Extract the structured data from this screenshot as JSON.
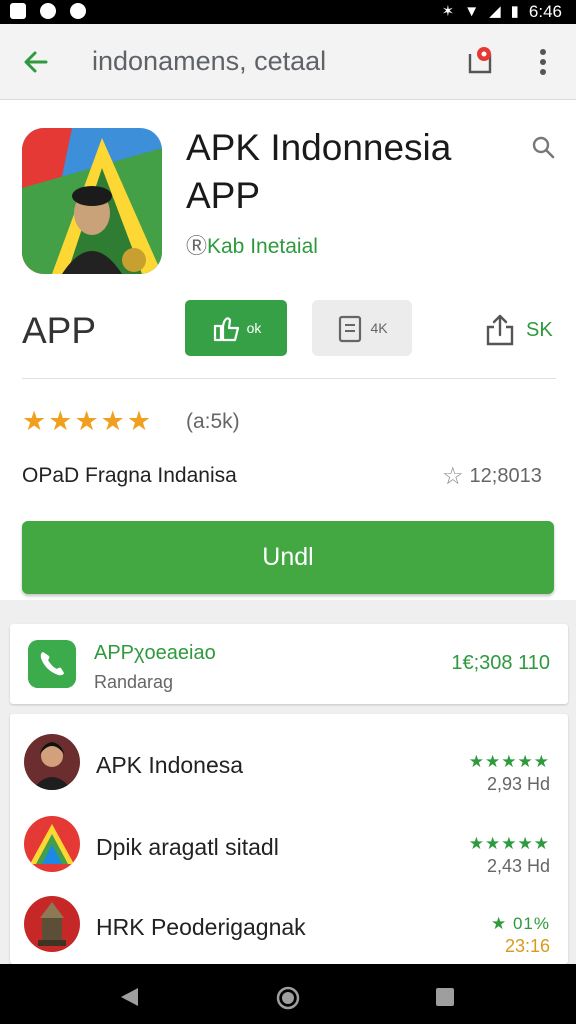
{
  "status_bar": {
    "time": "6:46"
  },
  "app_bar": {
    "title": "indonamens, cetaal"
  },
  "header": {
    "app_title": "APK Indonnesia APP",
    "developer": "Kab Inetaial",
    "app_label": "APP",
    "install_count": "ok",
    "wishlist_count": "4K",
    "share_label": "SK",
    "rating_count": "(a:5k)",
    "meta_left": "OPaD Fragna Indanisa",
    "meta_right": "12;8013",
    "open_button": "Undl"
  },
  "featured": {
    "title": "APPχoeaeiao",
    "subtitle": "Randarag",
    "price": "1€;308 110"
  },
  "list": [
    {
      "name": "APK Indonesa",
      "stars": "★★★★★",
      "count": "2,93 Hd"
    },
    {
      "name": "Dpik aragatl sitadl",
      "stars": "★★★★★",
      "count": "2,43 Hd"
    },
    {
      "name": "HRK Peoderigagnak",
      "stars": "★ 01%",
      "count": "23:16"
    }
  ],
  "colors": {
    "accent": "#36a046",
    "star": "#f0a01e",
    "nav": "#000000"
  },
  "icons": [
    "back-arrow-icon",
    "shop-icon",
    "more-vert-icon",
    "search-icon",
    "thumbs-up-icon",
    "wishlist-icon",
    "share-icon",
    "star-outline-icon",
    "phone-icon"
  ]
}
